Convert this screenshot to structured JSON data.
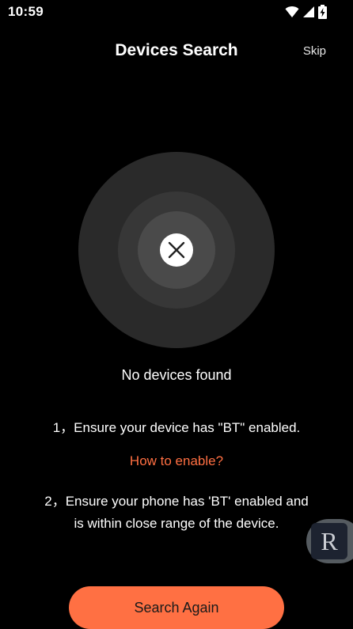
{
  "status_bar": {
    "time": "10:59",
    "icons": [
      "wifi-icon",
      "signal-icon",
      "battery-charging-icon"
    ]
  },
  "header": {
    "title": "Devices Search",
    "skip_label": "Skip"
  },
  "radar": {
    "state_icon": "close-icon"
  },
  "result": {
    "message": "No devices found"
  },
  "tips": {
    "tip1": "1，Ensure your device has \"BT\" enabled.",
    "how_to_enable": "How to enable?",
    "tip2": "2，Ensure your phone has 'BT' enabled and is within close range of the device."
  },
  "floating_button": {
    "letter": "R"
  },
  "actions": {
    "search_again": "Search Again"
  },
  "colors": {
    "accent": "#ff7043",
    "link": "#ff6f42",
    "background": "#000000"
  }
}
